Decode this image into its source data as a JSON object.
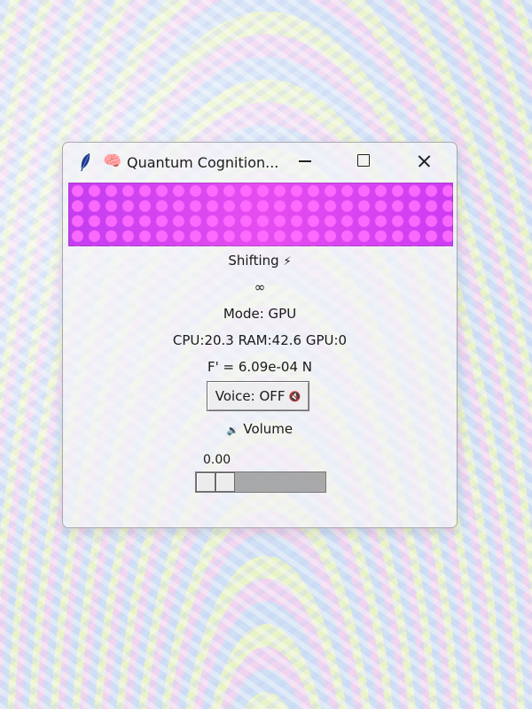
{
  "window": {
    "title": "Quantum Cognition...",
    "app_icon": "feather-icon",
    "title_emoji": "🧠",
    "controls": {
      "minimize": "minimize-icon",
      "maximize": "maximize-icon",
      "close": "close-icon"
    }
  },
  "spectrum": {
    "colors": [
      "#c43df0",
      "#e64df0",
      "#ff6eff"
    ]
  },
  "status": {
    "state": "Shifting",
    "state_icon": "⚡",
    "symbol": "∞",
    "mode": "Mode: GPU",
    "resources": "CPU:20.3 RAM:42.6 GPU:0",
    "force": "F' = 6.09e-04 N"
  },
  "voice": {
    "label": "Voice: OFF",
    "icon": "🔇"
  },
  "volume": {
    "icon": "🔉",
    "label": "Volume",
    "value_text": "0.00",
    "value": 0.0
  }
}
